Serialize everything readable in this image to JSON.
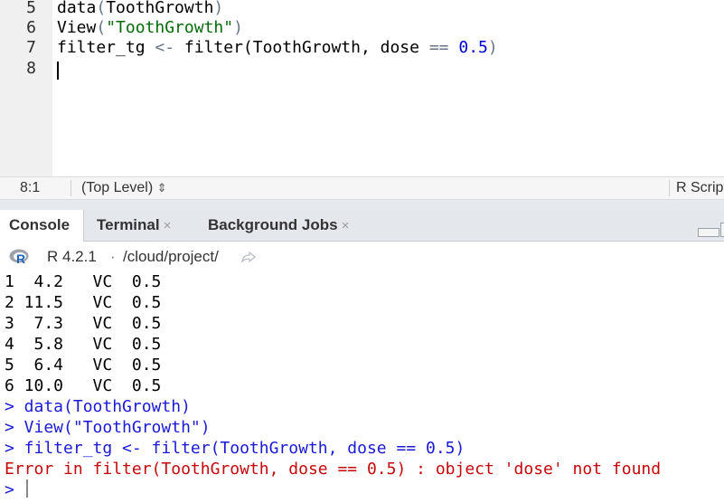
{
  "editor": {
    "line_numbers": [
      "5",
      "6",
      "7",
      "8"
    ],
    "lines": [
      {
        "fn": "data",
        "open": "(",
        "arg": "ToothGrowth",
        "close": ")"
      },
      {
        "fn": "View",
        "open": "(",
        "str": "\"ToothGrowth\"",
        "close": ")"
      },
      {
        "lhs": "filter_tg ",
        "assign": "<-",
        "mid": " filter(ToothGrowth, dose ",
        "eq": "==",
        "sp": " ",
        "num": "0.5",
        "close": ")"
      }
    ]
  },
  "status": {
    "position": "8:1",
    "scope": "(Top Level)",
    "scope_arrows": "⇕",
    "file_type": "R Script"
  },
  "tabs": [
    {
      "label": "Console",
      "close": ""
    },
    {
      "label": "Terminal",
      "close": "×"
    },
    {
      "label": "Background Jobs",
      "close": "×"
    }
  ],
  "console_header": {
    "version": "R 4.2.1",
    "separator": "·",
    "path": "/cloud/project/"
  },
  "console": {
    "output_rows": [
      "1  4.2   VC  0.5",
      "2 11.5   VC  0.5",
      "3  7.3   VC  0.5",
      "4  5.8   VC  0.5",
      "5  6.4   VC  0.5",
      "6 10.0   VC  0.5"
    ],
    "commands": [
      "> data(ToothGrowth)",
      "> View(\"ToothGrowth\")",
      "> filter_tg <- filter(ToothGrowth, dose == 0.5)"
    ],
    "error": "Error in filter(ToothGrowth, dose == 0.5) : object 'dose' not found",
    "prompt": ">"
  },
  "colors": {
    "string": "#036a07",
    "number": "#0000cd",
    "command": "#1a1ad6",
    "error": "#c5060b",
    "r_logo": "#2066b8"
  }
}
